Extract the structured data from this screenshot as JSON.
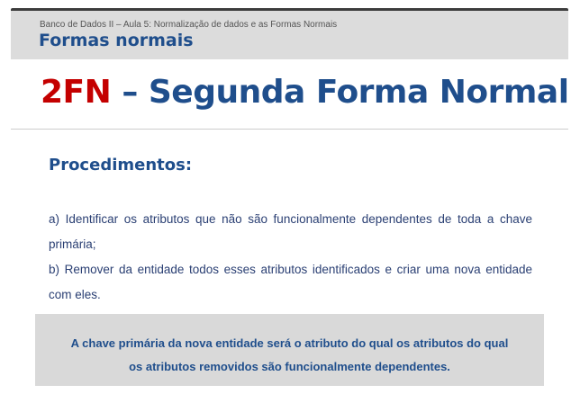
{
  "header": {
    "breadcrumb": "Banco de Dados II – Aula 5: Normalização de dados e as Formas Normais",
    "title": "Formas normais"
  },
  "slide": {
    "title_acronym": "2FN",
    "title_rest": " – Segunda Forma Normal",
    "section_heading": "Procedimentos:",
    "procedures": [
      "a) Identificar os atributos que não são funcionalmente dependentes de toda a chave primária;",
      "b) Remover da entidade todos esses atributos identificados e criar uma nova entidade com eles."
    ],
    "note_line1": "A chave primária da nova entidade será o atributo do qual os atributos do qual",
    "note_line2": "os atributos removidos são funcionalmente dependentes."
  },
  "colors": {
    "accent_red": "#c40000",
    "accent_blue": "#1f4e8c",
    "band_gray": "#dcdcdc",
    "note_gray": "#d9d9d9"
  }
}
